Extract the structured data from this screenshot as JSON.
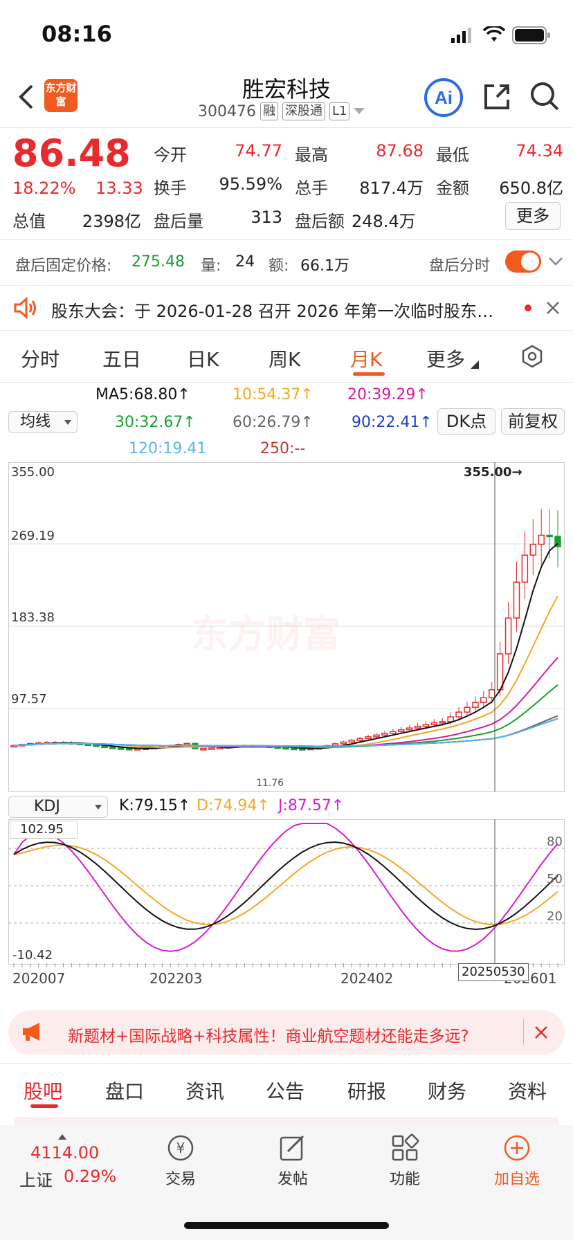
{
  "status": {
    "time": "08:16"
  },
  "header": {
    "logo_text": "东方财富",
    "title": "胜宏科技",
    "code": "300476",
    "tags": [
      "融",
      "深股通",
      "L1"
    ]
  },
  "quote": {
    "price": "86.48",
    "change_pct": "18.22%",
    "change": "13.33",
    "open_label": "今开",
    "open": "74.77",
    "high_label": "最高",
    "high": "87.68",
    "low_label": "最低",
    "low": "74.34",
    "turnover_label": "换手",
    "turnover": "95.59%",
    "volume_label": "总手",
    "volume": "817.4万",
    "amount_label": "金额",
    "amount": "650.8亿",
    "cap_label": "总值",
    "cap": "2398亿",
    "ah_vol_label": "盘后量",
    "ah_vol": "313",
    "ah_amt_label": "盘后额",
    "ah_amt": "248.4万",
    "more": "更多"
  },
  "afterhours": {
    "price_label": "盘后固定价格:",
    "price": "275.48",
    "vol_label": "量:",
    "vol": "24",
    "amt_label": "额:",
    "amt": "66.1万",
    "toggle_label": "盘后分时"
  },
  "notice": {
    "text": "股东大会：于 2026-01-28 召开 2026 年第一次临时股东…"
  },
  "tabs": [
    "分时",
    "五日",
    "日K",
    "周K",
    "月K",
    "更多"
  ],
  "active_tab": "月K",
  "ma": {
    "selector": "均线",
    "ma5": "MA5:68.80↑",
    "ma10": "10:54.37↑",
    "ma20": "20:39.29↑",
    "ma30": "30:32.67↑",
    "ma60": "60:26.79↑",
    "ma90": "90:22.41↑",
    "ma120": "120:19.41",
    "ma250": "250:--",
    "dk": "DK点",
    "adjust": "前复权"
  },
  "colors": {
    "up": "#e8292d",
    "down": "#1a9f2f",
    "accent": "#f25a1e",
    "ma5": "#111111",
    "ma10": "#f5a623",
    "ma20": "#d81b9c",
    "ma30": "#1a9f2f",
    "ma60": "#666666",
    "ma90": "#1f3fc8",
    "ma120": "#5ab4f0"
  },
  "kchart": {
    "y_labels": [
      "355.00",
      "269.19",
      "183.38",
      "97.57"
    ],
    "max_marker": "355.00→",
    "low_marker": "11.76",
    "watermark": "东方财富"
  },
  "kdj": {
    "selector": "KDJ",
    "k": "K:79.15↑",
    "d": "D:74.94↑",
    "j": "J:87.57↑",
    "ymax": "102.95",
    "ymin": "-10.42",
    "levels": [
      "80",
      "50",
      "20"
    ]
  },
  "xaxis": {
    "labels": [
      "202007",
      "202203",
      "202402",
      "202601"
    ],
    "cursor": "20250530"
  },
  "banner": {
    "text": "新题材+国际战略+科技属性！商业航空题材还能走多远?"
  },
  "bottom_tabs": [
    "股吧",
    "盘口",
    "资讯",
    "公告",
    "研报",
    "财务",
    "资料"
  ],
  "bottom_nav": {
    "index_value": "4114.00",
    "index_name": "上证",
    "index_pct": "0.29%",
    "items": [
      "交易",
      "发帖",
      "功能",
      "加自选"
    ]
  }
}
